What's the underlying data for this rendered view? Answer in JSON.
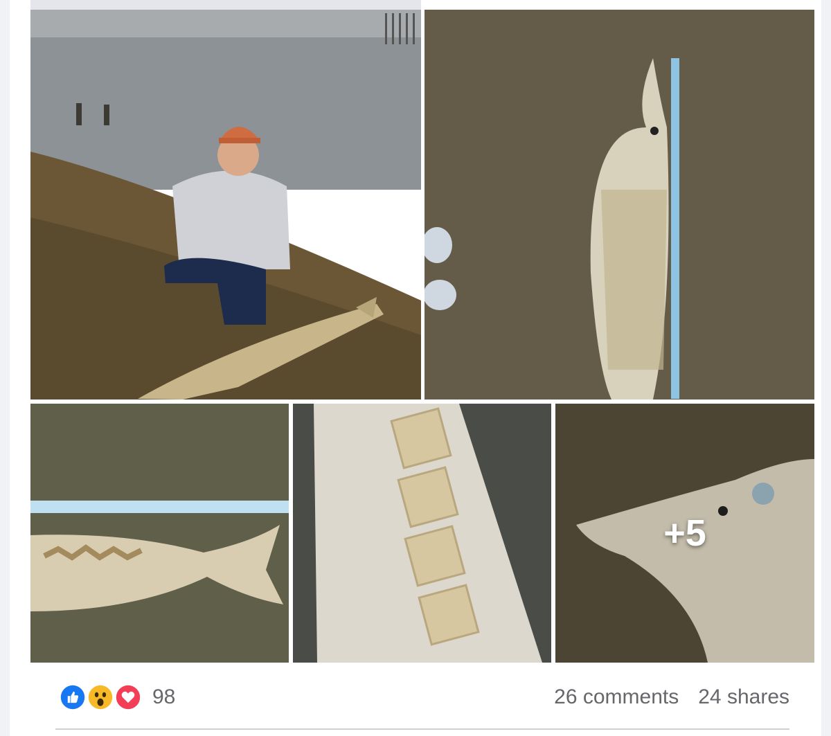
{
  "post": {
    "photos": [
      {
        "name": "photo-woman-with-sturgeon"
      },
      {
        "name": "photo-sturgeon-with-tape"
      },
      {
        "name": "photo-sturgeon-tail"
      },
      {
        "name": "photo-sturgeon-scutes"
      },
      {
        "name": "photo-sturgeon-head"
      }
    ],
    "more_photos_label": "+5"
  },
  "reactions": {
    "icons": [
      "like-icon",
      "wow-icon",
      "love-icon"
    ],
    "colors": {
      "like": "#1877f2",
      "wow": "#f7b928",
      "love": "#f33e58"
    },
    "count": "98"
  },
  "engagement": {
    "comments": "26 comments",
    "shares": "24 shares"
  }
}
